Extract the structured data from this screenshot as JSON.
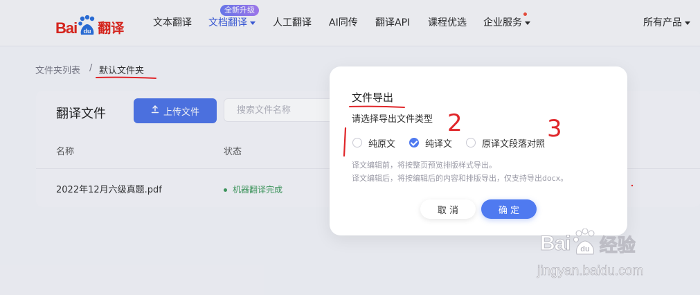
{
  "header": {
    "logo_text": "Bai",
    "logo_du": "du",
    "logo_product": "翻译",
    "nav": [
      {
        "label": "文本翻译"
      },
      {
        "label": "文档翻译",
        "badge": "全新升级"
      },
      {
        "label": "人工翻译"
      },
      {
        "label": "AI同传"
      },
      {
        "label": "翻译API"
      },
      {
        "label": "课程优选"
      },
      {
        "label": "企业服务"
      }
    ],
    "all_products": "所有产品"
  },
  "breadcrumb": {
    "parent": "文件夹列表",
    "separator": "/",
    "current": "默认文件夹"
  },
  "main": {
    "title": "翻译文件",
    "upload_button": "上传文件",
    "search_placeholder": "搜索文件名称",
    "columns": [
      "名称",
      "状态"
    ],
    "rows": [
      {
        "name": "2022年12月六级真题.pdf",
        "status": "机器翻译完成"
      }
    ]
  },
  "modal": {
    "title": "文件导出",
    "subtitle": "请选择导出文件类型",
    "options": [
      {
        "label": "纯原文",
        "selected": false
      },
      {
        "label": "纯译文",
        "selected": true
      },
      {
        "label": "原译文段落对照",
        "selected": false
      }
    ],
    "hints": [
      "译文编辑前，将按整页预览排版样式导出。",
      "译文编辑后，将按编辑后的内容和排版导出，仅支持导出docx。"
    ],
    "cancel": "取 消",
    "confirm": "确 定"
  },
  "annotations": {
    "mark_2": "2",
    "mark_3": "3"
  },
  "watermark": {
    "brand": "Bai",
    "du": "du",
    "product": "经验",
    "url": "jingyan.baidu.com"
  },
  "colors": {
    "brand_red": "#e1251b",
    "accent_blue": "#4f7af0",
    "annotation_red": "#e0262a",
    "status_green": "#3f9b5d"
  }
}
